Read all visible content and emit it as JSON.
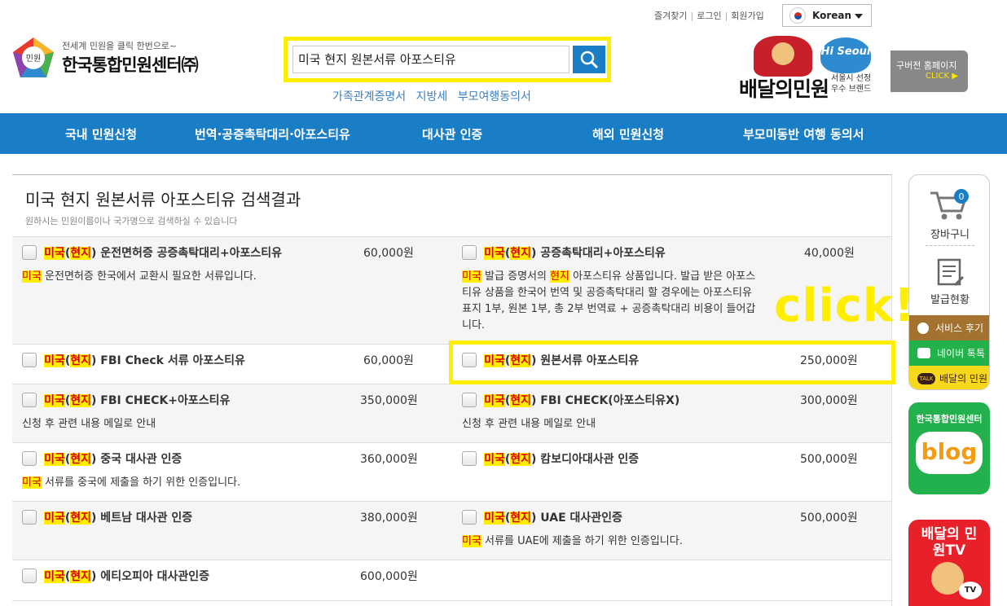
{
  "header": {
    "utility_links": [
      "즐겨찾기",
      "로그인",
      "회원가입"
    ],
    "language": "Korean",
    "logo_badge": "민원",
    "logo_sub": "전세계 민원을 클릭 한번으로~",
    "logo_main": "한국통합민원센터㈜",
    "search_value": "미국 현지 원본서류 아포스티유",
    "quick_links": [
      "가족관계증명서",
      "지방세",
      "부모여행동의서"
    ],
    "brand_title": "배달의민원",
    "brand_hi": "Hi Seoul",
    "brand_sub": "서울시 선정 우수 브랜드",
    "old_home": "구버전 홈페이지",
    "old_home_click": "CLICK ▶"
  },
  "nav": [
    "국내 민원신청",
    "번역·공증촉탁대리·아포스티유",
    "대사관 인증",
    "해외 민원신청",
    "부모미동반 여행 동의서"
  ],
  "results": {
    "title": "미국 현지 원본서류 아포스티유 검색결과",
    "subtitle": "원하시는 민원이름이나 국가명으로 검색하실 수 있습니다",
    "rows": [
      {
        "left": {
          "hl1": "미국",
          "hl2": "현지",
          "rest": " 운전면허증 공증촉탁대리+아포스티유",
          "price": "60,000원",
          "desc_hl": "미국",
          "desc": " 운전면허증 한국에서 교환시 필요한 서류입니다."
        },
        "right": {
          "hl1": "미국",
          "hl2": "현지",
          "rest": " 공증촉탁대리+아포스티유",
          "price": "40,000원",
          "desc_hl": "미국",
          "desc_mid": " 발급 증명서의 ",
          "desc_hl2": "현지",
          "desc": " 아포스티유 상품입니다. 발급 받은 아포스티유 상품을 한국어 번역 및 공증촉탁대리 할 경우에는 아포스티유 표지 1부, 원본 1부, 총 2부 번역료 + 공증촉탁대리 비용이 들어갑니다."
        }
      },
      {
        "left": {
          "hl1": "미국",
          "hl2": "현지",
          "rest": " FBI Check 서류 아포스티유",
          "price": "60,000원"
        },
        "right": {
          "hl1": "미국",
          "hl2": "현지",
          "rest": " 원본서류 아포스티유",
          "price": "250,000원"
        }
      },
      {
        "left": {
          "hl1": "미국",
          "hl2": "현지",
          "rest": " FBI CHECK+아포스티유",
          "price": "350,000원",
          "desc": "신청 후 관련 내용 메일로 안내"
        },
        "right": {
          "hl1": "미국",
          "hl2": "현지",
          "rest": " FBI CHECK(아포스티유X)",
          "price": "300,000원",
          "desc": "신청 후 관련 내용 메일로 안내"
        }
      },
      {
        "left": {
          "hl1": "미국",
          "hl2": "현지",
          "rest": " 중국 대사관 인증",
          "price": "360,000원",
          "desc_hl": "미국",
          "desc": " 서류를 중국에 제출을 하기 위한 인증입니다."
        },
        "right": {
          "hl1": "미국",
          "hl2": "현지",
          "rest": " 캄보디아대사관 인증",
          "price": "500,000원"
        }
      },
      {
        "left": {
          "hl1": "미국",
          "hl2": "현지",
          "rest": " 베트남 대사관 인증",
          "price": "380,000원"
        },
        "right": {
          "hl1": "미국",
          "hl2": "현지",
          "rest": " UAE 대사관인증",
          "price": "500,000원",
          "desc_hl": "미국",
          "desc": " 서류를 UAE에 제출을 하기 위한 인증입니다."
        }
      },
      {
        "left": {
          "hl1": "미국",
          "hl2": "현지",
          "rest": " 에티오피아 대사관인증",
          "price": "600,000원"
        }
      }
    ]
  },
  "annotation": {
    "click": "click!"
  },
  "sidebar": {
    "cart_count": "0",
    "cart_label": "장바구니",
    "issue_label": "발급현황",
    "service_review": "서비스 후기",
    "naver_talk": "네이버 톡톡",
    "kakao": "배달의 민원",
    "blog_top": "한국통합민원센터",
    "blog_word": "blog",
    "tv_title": "배달의 민원TV",
    "tv_badge": "TV"
  },
  "colors": {
    "brand_blue": "#1a7ec7",
    "highlight_yellow": "#ffee00",
    "highlight_red": "#d90000"
  }
}
